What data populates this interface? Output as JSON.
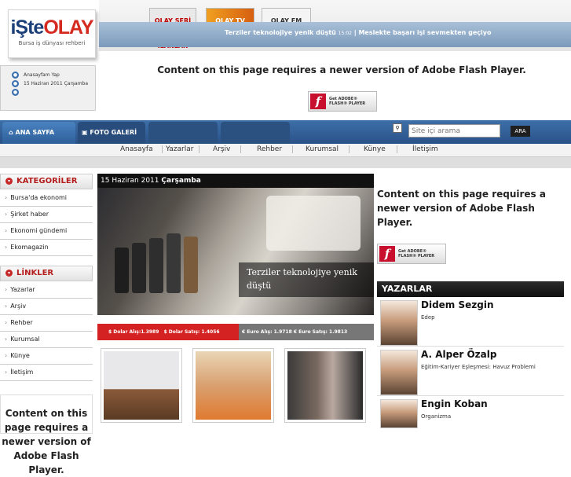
{
  "logo": {
    "brand_a": "iŞte",
    "brand_b": "OLAY",
    "tagline": "Bursa iş dünyası rehberi"
  },
  "top_buttons": {
    "seri": "OLAY SERİ İLANLAR",
    "tv": "OLAY TV",
    "fm": "OLAY FM"
  },
  "ticker": {
    "item1": "Terziler teknolojiye yenik düştü",
    "item1_time": "15:02",
    "separator": "|",
    "item2": "Meslekte başarı işi sevmekten geçiyo"
  },
  "flash_notice": "Content on this page requires a newer version of Adobe Flash Player.",
  "get_flash": {
    "line1": "Get ADOBE®",
    "line2": "FLASH® PLAYER"
  },
  "date_box": {
    "homepage": "Anasayfam Yap",
    "date": "15 Haziran 2011 Çarşamba"
  },
  "nav": {
    "tabs": [
      "ANA SAYFA",
      "FOTO GALERİ",
      "",
      ""
    ]
  },
  "search": {
    "placeholder": "Site içi arama",
    "button": "ARA"
  },
  "subnav": [
    "Anasayfa",
    "Yazarlar",
    "Arşiv",
    "Rehber",
    "Kurumsal",
    "Künye",
    "İletişim"
  ],
  "categories": {
    "title": "KATEGORİLER",
    "items": [
      "Bursa'da ekonomi",
      "Şirket haber",
      "Ekonomi gündemi",
      "Ekomagazin"
    ]
  },
  "links": {
    "title": "LİNKLER",
    "items": [
      "Yazarlar",
      "Arşiv",
      "Rehber",
      "Kurumsal",
      "Künye",
      "İletişim"
    ]
  },
  "headline": {
    "date_plain": "15 Haziran 2011",
    "date_bold": "Çarşamba",
    "title": "Terziler teknolojiye yenik düştü"
  },
  "currency": {
    "dollar_buy_label": "$ Dolar Alış:",
    "dollar_buy": "1.3989",
    "dollar_sell_label": "$ Dolar Satış:",
    "dollar_sell": "1.4056",
    "euro_buy_label": "€ Euro Alış:",
    "euro_buy": "1.9718",
    "euro_sell_label": "€ Euro Satış:",
    "euro_sell": "1.9813"
  },
  "authors": {
    "title": "YAZARLAR",
    "items": [
      {
        "name": "Didem Sezgin",
        "topic": "Edep"
      },
      {
        "name": "A. Alper Özalp",
        "topic": "Eğitim-Kariyer Eşleşmesi: Havuz Problemi"
      },
      {
        "name": "Engin Koban",
        "topic": "Organizma"
      }
    ]
  },
  "colors": {
    "nav_blue": "#2a5288",
    "accent_red": "#d42121"
  }
}
